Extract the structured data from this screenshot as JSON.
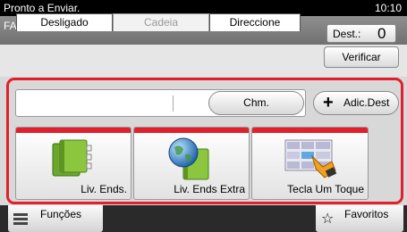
{
  "status": {
    "message": "Pronto a Enviar.",
    "time": "10:10"
  },
  "header": {
    "mode": "FAX",
    "dest_label": "Dest.:",
    "dest_count": "0"
  },
  "tabs": [
    {
      "label": "Desligado",
      "enabled": true
    },
    {
      "label": "Cadeia",
      "enabled": false
    },
    {
      "label": "Direccione",
      "enabled": true
    }
  ],
  "verify_label": "Verificar",
  "address": {
    "value": "",
    "chm_label": "Chm.",
    "add_label": "Adic.Dest"
  },
  "tiles": [
    {
      "label": "Liv. Ends.",
      "icon": "address-book-icon"
    },
    {
      "label": "Liv. Ends Extra",
      "icon": "globe-book-icon"
    },
    {
      "label": "Tecla Um Toque",
      "icon": "one-touch-key-icon"
    }
  ],
  "bottom": {
    "functions_label": "Funções",
    "favorites_label": "Favoritos"
  },
  "colors": {
    "accent": "#e0202a",
    "statusbar": "#000000",
    "header": "#7f7f7f"
  }
}
